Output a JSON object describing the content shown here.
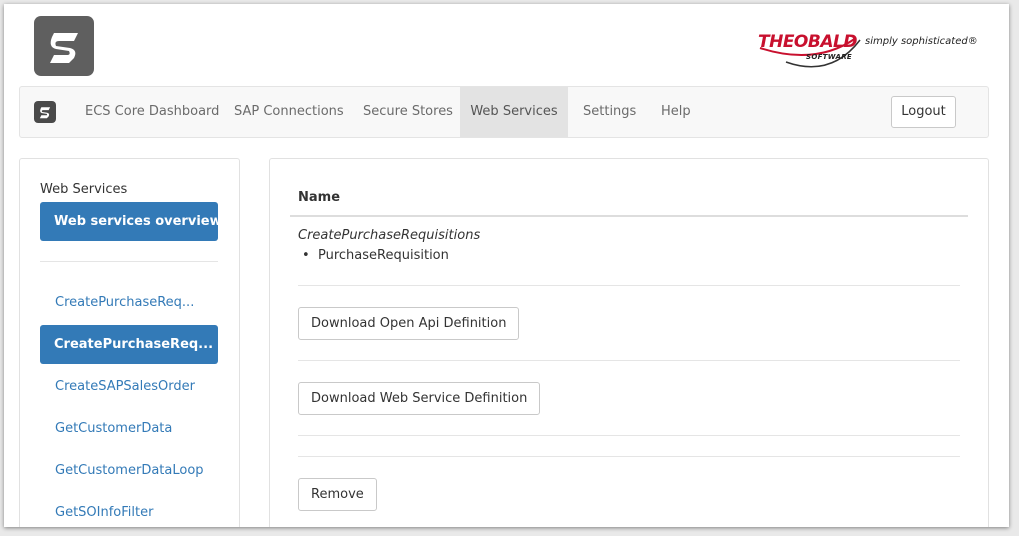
{
  "brand": {
    "name": "THEOBALD",
    "sub": "SOFTWARE",
    "tagline": "simply sophisticated®",
    "colors": {
      "red": "#c8102e",
      "dark": "#222222"
    }
  },
  "app_logo_icon": "s-logo-icon",
  "nav": {
    "items": [
      "ECS Core Dashboard",
      "SAP Connections",
      "Secure Stores",
      "Web Services",
      "Settings",
      "Help"
    ],
    "active": "Web Services",
    "logout_label": "Logout"
  },
  "sidebar": {
    "title": "Web Services",
    "overview_label": "Web services overview",
    "items": [
      {
        "label": "CreatePurchaseReq...",
        "active": false
      },
      {
        "label": "CreatePurchaseReq...",
        "active": true
      },
      {
        "label": "CreateSAPSalesOrder",
        "active": false
      },
      {
        "label": "GetCustomerData",
        "active": false
      },
      {
        "label": "GetCustomerDataLoop",
        "active": false
      },
      {
        "label": "GetSOInfoFilter",
        "active": false
      }
    ]
  },
  "main": {
    "column_header": "Name",
    "service_name": "CreatePurchaseRequisitions",
    "parameters": [
      "PurchaseRequisition"
    ],
    "download_openapi_label": "Download Open Api Definition",
    "download_wsdl_label": "Download Web Service Definition",
    "remove_label": "Remove"
  },
  "colors": {
    "accent": "#337ab7",
    "nav_active_bg": "#e3e3e3",
    "logo_bg": "#5f5f5f"
  }
}
